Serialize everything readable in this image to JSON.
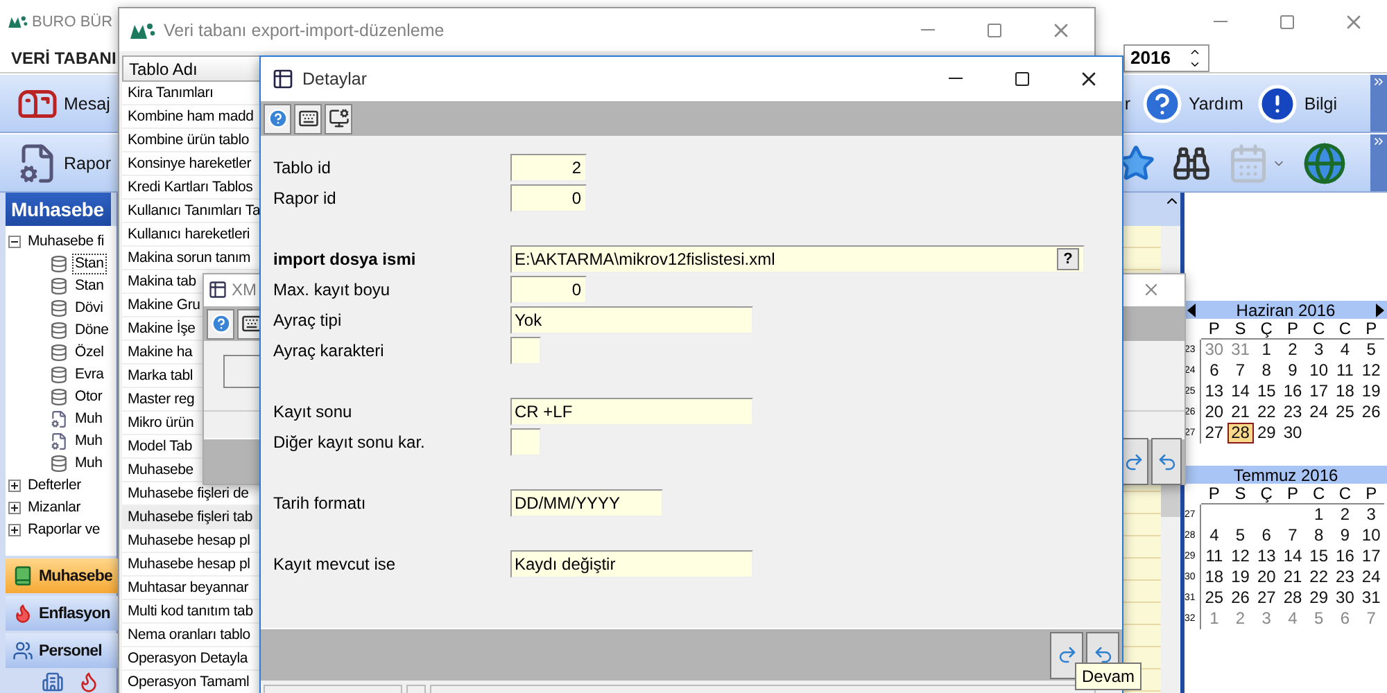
{
  "main_window": {
    "title": "BURO BÜR",
    "menu": [
      {
        "label": "VERİ TABANI"
      }
    ],
    "year": "2016",
    "toolbar_rows": [
      {
        "buttons": [
          {
            "label": "Mesaj",
            "kind": "mail"
          }
        ],
        "tools": [
          {
            "label": "r",
            "kind": "text",
            "disabled": false
          },
          {
            "label": "Yardım",
            "kind": "help",
            "disabled": false
          },
          {
            "label": "Bilgi",
            "kind": "info",
            "disabled": false
          }
        ]
      },
      {
        "buttons": [
          {
            "label": "Rapor",
            "kind": "report"
          }
        ],
        "tools": [
          {
            "kind": "star",
            "disabled": false
          },
          {
            "kind": "binoculars",
            "disabled": false
          },
          {
            "kind": "calendar",
            "disabled": true
          },
          {
            "kind": "globe",
            "disabled": false
          }
        ]
      }
    ],
    "sidebar": {
      "title": "Muhasebe",
      "tree": [
        {
          "label": "Muhasebe fi",
          "expanded": true,
          "selected": false,
          "children": [
            {
              "label": "Stan",
              "kind": "table",
              "selected": true
            },
            {
              "label": "Stan",
              "kind": "table",
              "selected": false
            },
            {
              "label": "Dövi",
              "kind": "table",
              "selected": false
            },
            {
              "label": "Döne",
              "kind": "table",
              "selected": false
            },
            {
              "label": "Özel",
              "kind": "table",
              "selected": false
            },
            {
              "label": "Evra",
              "kind": "table",
              "selected": false
            },
            {
              "label": "Otor",
              "kind": "table",
              "selected": false
            },
            {
              "label": "Muh",
              "kind": "gear",
              "selected": false
            },
            {
              "label": "Muh",
              "kind": "gear",
              "selected": false
            },
            {
              "label": "Muh",
              "kind": "table",
              "selected": false
            }
          ]
        },
        {
          "label": "Defterler",
          "expanded": false,
          "selected": false
        },
        {
          "label": "Mizanlar",
          "expanded": false,
          "selected": false
        },
        {
          "label": "Raporlar ve",
          "expanded": false,
          "selected": false
        }
      ],
      "nav": [
        {
          "label": "Muhasebe",
          "kind": "book",
          "selected": true
        },
        {
          "label": "Enflasyon",
          "kind": "fire",
          "selected": false
        },
        {
          "label": "Personel",
          "kind": "people",
          "selected": false
        }
      ]
    },
    "calendars": [
      {
        "title": "Haziran 2016",
        "nav": true,
        "week_days": [
          "P",
          "S",
          "Ç",
          "P",
          "C",
          "C",
          "P"
        ],
        "weeks": [
          {
            "number": "23",
            "days": [
              {
                "kind": "day",
                "text": "30",
                "muted": true,
                "selected": false
              },
              {
                "kind": "day",
                "text": "31",
                "muted": true,
                "selected": false
              },
              {
                "kind": "day",
                "text": "1",
                "muted": false,
                "selected": false
              },
              {
                "kind": "day",
                "text": "2",
                "muted": false,
                "selected": false
              },
              {
                "kind": "day",
                "text": "3",
                "muted": false,
                "selected": false
              },
              {
                "kind": "day",
                "text": "4",
                "muted": false,
                "selected": false
              },
              {
                "kind": "day",
                "text": "5",
                "muted": false,
                "selected": false
              }
            ]
          },
          {
            "number": "24",
            "days": [
              {
                "kind": "day",
                "text": "6",
                "muted": false,
                "selected": false
              },
              {
                "kind": "day",
                "text": "7",
                "muted": false,
                "selected": false
              },
              {
                "kind": "day",
                "text": "8",
                "muted": false,
                "selected": false
              },
              {
                "kind": "day",
                "text": "9",
                "muted": false,
                "selected": false
              },
              {
                "kind": "day",
                "text": "10",
                "muted": false,
                "selected": false
              },
              {
                "kind": "day",
                "text": "11",
                "muted": false,
                "selected": false
              },
              {
                "kind": "day",
                "text": "12",
                "muted": false,
                "selected": false
              }
            ]
          },
          {
            "number": "25",
            "days": [
              {
                "kind": "day",
                "text": "13",
                "muted": false,
                "selected": false
              },
              {
                "kind": "day",
                "text": "14",
                "muted": false,
                "selected": false
              },
              {
                "kind": "day",
                "text": "15",
                "muted": false,
                "selected": false
              },
              {
                "kind": "day",
                "text": "16",
                "muted": false,
                "selected": false
              },
              {
                "kind": "day",
                "text": "17",
                "muted": false,
                "selected": false
              },
              {
                "kind": "day",
                "text": "18",
                "muted": false,
                "selected": false
              },
              {
                "kind": "day",
                "text": "19",
                "muted": false,
                "selected": false
              }
            ]
          },
          {
            "number": "26",
            "days": [
              {
                "kind": "day",
                "text": "20",
                "muted": false,
                "selected": false
              },
              {
                "kind": "day",
                "text": "21",
                "muted": false,
                "selected": false
              },
              {
                "kind": "day",
                "text": "22",
                "muted": false,
                "selected": false
              },
              {
                "kind": "day",
                "text": "23",
                "muted": false,
                "selected": false
              },
              {
                "kind": "day",
                "text": "24",
                "muted": false,
                "selected": false
              },
              {
                "kind": "day",
                "text": "25",
                "muted": false,
                "selected": false
              },
              {
                "kind": "day",
                "text": "26",
                "muted": false,
                "selected": false
              }
            ]
          },
          {
            "number": "27",
            "days": [
              {
                "kind": "day",
                "text": "27",
                "muted": false,
                "selected": false
              },
              {
                "kind": "day",
                "text": "28",
                "muted": false,
                "selected": true
              },
              {
                "kind": "day",
                "text": "29",
                "muted": false,
                "selected": false
              },
              {
                "kind": "day",
                "text": "30",
                "muted": false,
                "selected": false
              }
            ]
          }
        ]
      },
      {
        "title": "Temmuz 2016",
        "nav": false,
        "week_days": [
          "P",
          "S",
          "Ç",
          "P",
          "C",
          "C",
          "P"
        ],
        "weeks": [
          {
            "number": "27",
            "days": [
              {
                "kind": "blank"
              },
              {
                "kind": "blank"
              },
              {
                "kind": "blank"
              },
              {
                "kind": "blank"
              },
              {
                "kind": "day",
                "text": "1",
                "muted": false,
                "selected": false
              },
              {
                "kind": "day",
                "text": "2",
                "muted": false,
                "selected": false
              },
              {
                "kind": "day",
                "text": "3",
                "muted": false,
                "selected": false
              }
            ]
          },
          {
            "number": "28",
            "days": [
              {
                "kind": "day",
                "text": "4",
                "muted": false,
                "selected": false
              },
              {
                "kind": "day",
                "text": "5",
                "muted": false,
                "selected": false
              },
              {
                "kind": "day",
                "text": "6",
                "muted": false,
                "selected": false
              },
              {
                "kind": "day",
                "text": "7",
                "muted": false,
                "selected": false
              },
              {
                "kind": "day",
                "text": "8",
                "muted": false,
                "selected": false
              },
              {
                "kind": "day",
                "text": "9",
                "muted": false,
                "selected": false
              },
              {
                "kind": "day",
                "text": "10",
                "muted": false,
                "selected": false
              }
            ]
          },
          {
            "number": "29",
            "days": [
              {
                "kind": "day",
                "text": "11",
                "muted": false,
                "selected": false
              },
              {
                "kind": "day",
                "text": "12",
                "muted": false,
                "selected": false
              },
              {
                "kind": "day",
                "text": "13",
                "muted": false,
                "selected": false
              },
              {
                "kind": "day",
                "text": "14",
                "muted": false,
                "selected": false
              },
              {
                "kind": "day",
                "text": "15",
                "muted": false,
                "selected": false
              },
              {
                "kind": "day",
                "text": "16",
                "muted": false,
                "selected": false
              },
              {
                "kind": "day",
                "text": "17",
                "muted": false,
                "selected": false
              }
            ]
          },
          {
            "number": "30",
            "days": [
              {
                "kind": "day",
                "text": "18",
                "muted": false,
                "selected": false
              },
              {
                "kind": "day",
                "text": "19",
                "muted": false,
                "selected": false
              },
              {
                "kind": "day",
                "text": "20",
                "muted": false,
                "selected": false
              },
              {
                "kind": "day",
                "text": "21",
                "muted": false,
                "selected": false
              },
              {
                "kind": "day",
                "text": "22",
                "muted": false,
                "selected": false
              },
              {
                "kind": "day",
                "text": "23",
                "muted": false,
                "selected": false
              },
              {
                "kind": "day",
                "text": "24",
                "muted": false,
                "selected": false
              }
            ]
          },
          {
            "number": "31",
            "days": [
              {
                "kind": "day",
                "text": "25",
                "muted": false,
                "selected": false
              },
              {
                "kind": "day",
                "text": "26",
                "muted": false,
                "selected": false
              },
              {
                "kind": "day",
                "text": "27",
                "muted": false,
                "selected": false
              },
              {
                "kind": "day",
                "text": "28",
                "muted": false,
                "selected": false
              },
              {
                "kind": "day",
                "text": "29",
                "muted": false,
                "selected": false
              },
              {
                "kind": "day",
                "text": "30",
                "muted": false,
                "selected": false
              },
              {
                "kind": "day",
                "text": "31",
                "muted": false,
                "selected": false
              }
            ]
          },
          {
            "number": "32",
            "days": [
              {
                "kind": "day",
                "text": "1",
                "muted": true,
                "selected": false
              },
              {
                "kind": "day",
                "text": "2",
                "muted": true,
                "selected": false
              },
              {
                "kind": "day",
                "text": "3",
                "muted": true,
                "selected": false
              },
              {
                "kind": "day",
                "text": "4",
                "muted": true,
                "selected": false
              },
              {
                "kind": "day",
                "text": "5",
                "muted": true,
                "selected": false
              },
              {
                "kind": "day",
                "text": "6",
                "muted": true,
                "selected": false
              },
              {
                "kind": "day",
                "text": "7",
                "muted": true,
                "selected": false
              }
            ]
          }
        ]
      }
    ]
  },
  "export_window": {
    "title": "Veri tabanı export-import-düzenleme",
    "column": "Tablo Adı",
    "rows": [
      {
        "label": "Kira Tanımları",
        "selected": false
      },
      {
        "label": "Kombine ham madd",
        "selected": false
      },
      {
        "label": "Kombine ürün tablo",
        "selected": false
      },
      {
        "label": "Konsinye hareketler",
        "selected": false
      },
      {
        "label": "Kredi Kartları Tablos",
        "selected": false
      },
      {
        "label": "Kullanıcı Tanımları Ta",
        "selected": false
      },
      {
        "label": "Kullanıcı hareketleri",
        "selected": false
      },
      {
        "label": "Makina sorun tanım",
        "selected": false
      },
      {
        "label": "Makina tab",
        "selected": false
      },
      {
        "label": "Makine Gru",
        "selected": false
      },
      {
        "label": "Makine İşe",
        "selected": false
      },
      {
        "label": "Makine ha",
        "selected": false
      },
      {
        "label": "Marka tabl",
        "selected": false
      },
      {
        "label": "Master reg",
        "selected": false
      },
      {
        "label": "Mikro ürün",
        "selected": false
      },
      {
        "label": "Model Tab",
        "selected": false
      },
      {
        "label": "Muhasebe",
        "selected": false
      },
      {
        "label": "Muhasebe fişleri de",
        "selected": false
      },
      {
        "label": "Muhasebe fişleri tab",
        "selected": true
      },
      {
        "label": "Muhasebe hesap pl",
        "selected": false
      },
      {
        "label": "Muhasebe hesap pl",
        "selected": false
      },
      {
        "label": "Muhtasar beyannar",
        "selected": false
      },
      {
        "label": "Multi kod tanıtım tab",
        "selected": false
      },
      {
        "label": "Nema oranları tablo",
        "selected": false
      },
      {
        "label": "Operasyon Detayla",
        "selected": false
      },
      {
        "label": "Operasyon Tamaml",
        "selected": false
      }
    ]
  },
  "xml_window": {
    "title": "XM"
  },
  "details_window": {
    "title": "Detaylar",
    "groups": [
      {
        "fields": [
          {
            "label": "Tablo id",
            "kind": "number",
            "value": "2",
            "bold": false
          },
          {
            "label": "Rapor id",
            "kind": "number",
            "value": "0",
            "bold": false
          }
        ]
      },
      {
        "fields": [
          {
            "label": "import dosya ismi",
            "kind": "file",
            "value": "E:\\AKTARMA\\mikrov12fislistesi.xml",
            "button": "?",
            "bold": true
          },
          {
            "label": "Max. kayıt boyu",
            "kind": "number",
            "value": "0",
            "bold": false
          },
          {
            "label": "Ayraç tipi",
            "kind": "choice",
            "value": "Yok",
            "bold": false
          },
          {
            "label": "Ayraç karakteri",
            "kind": "char",
            "bold": false
          }
        ]
      },
      {
        "fields": [
          {
            "label": "Kayıt sonu",
            "kind": "choice",
            "value": "CR +LF",
            "bold": false
          },
          {
            "label": "Diğer kayıt sonu kar.",
            "kind": "char",
            "bold": false
          }
        ]
      },
      {
        "fields": [
          {
            "label": "Tarih formatı",
            "kind": "date",
            "value": "DD/MM/YYYY",
            "bold": false
          }
        ]
      },
      {
        "fields": [
          {
            "label": "Kayıt mevcut ise",
            "kind": "choice",
            "value": "Kaydı değiştir",
            "bold": false
          }
        ]
      }
    ]
  },
  "tooltip": {
    "text": "Devam"
  }
}
